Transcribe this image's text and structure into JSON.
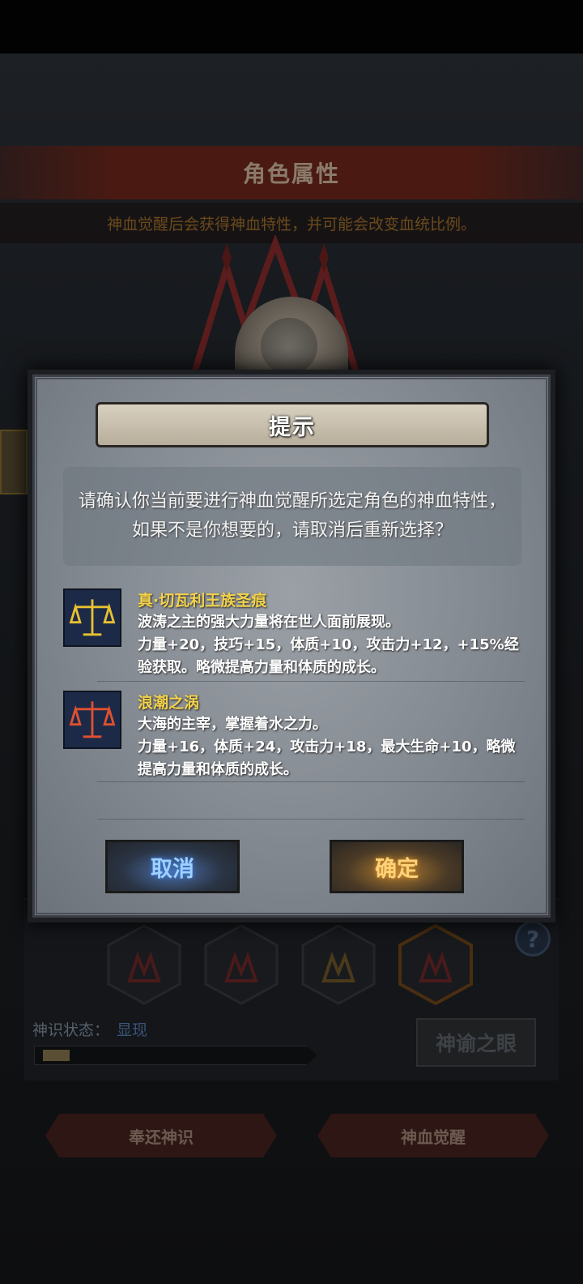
{
  "background": {
    "title": "角色属性",
    "subtitle": "神血觉醒后会获得神血特性，并可能会改变血统比例。",
    "status_label": "神识状态：",
    "status_value": "显现",
    "status_progress": 0.1,
    "eye_button": "神谕之眼",
    "help_icon": "?",
    "bottom_left_button": "奉还神识",
    "bottom_right_button": "神血觉醒"
  },
  "modal": {
    "title": "提示",
    "message": "请确认你当前要进行神血觉醒所选定角色的神血特性，如果不是你想要的，请取消后重新选择？",
    "traits": [
      {
        "name": "真·切瓦利王族圣痕",
        "description": "波涛之主的强大力量将在世人面前展现。",
        "stats": "力量+20，技巧+15，体质+10，攻击力+12，+15%经验获取。略微提高力量和体质的成长。",
        "icon": "golden-scales-icon",
        "icon_color": "#e8c030"
      },
      {
        "name": "浪潮之涡",
        "description": "大海的主宰，掌握着水之力。",
        "stats": "力量+16，体质+24，攻击力+18，最大生命+10，略微提高力量和体质的成长。",
        "icon": "red-scales-icon",
        "icon_color": "#e05030"
      }
    ],
    "cancel_button": "取消",
    "confirm_button": "确定"
  },
  "colors": {
    "trait_name": "#f3d24a",
    "cancel": "#9fd0ff",
    "confirm": "#ffd27a"
  }
}
